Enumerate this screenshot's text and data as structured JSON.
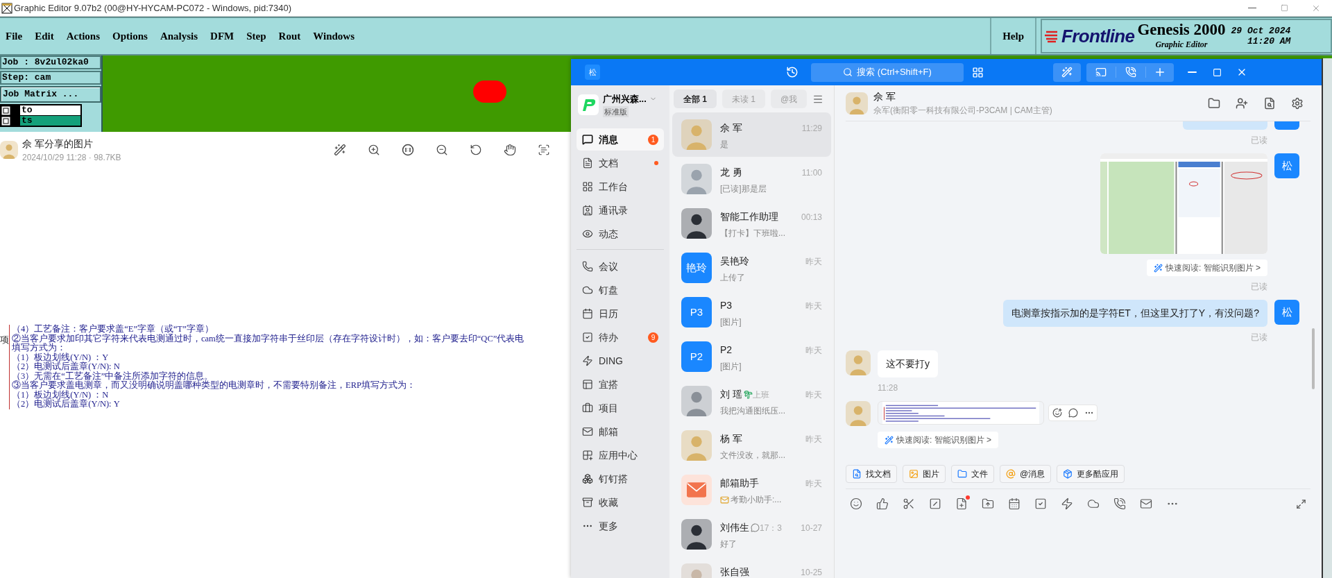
{
  "genesis": {
    "title": "Graphic Editor 9.07b2 (00@HY-HYCAM-PC072 - Windows, pid:7340)",
    "menu": [
      "File",
      "Edit",
      "Actions",
      "Options",
      "Analysis",
      "DFM",
      "Step",
      "Rout",
      "Windows"
    ],
    "help": "Help",
    "brand": {
      "logo": "Frontline",
      "product": "Genesis 2000",
      "subtitle": "Graphic Editor",
      "date": "29 Oct 2024",
      "time": "11:20 AM"
    },
    "job": "Job : 8v2ul02ka0",
    "step": "Step: cam",
    "matrix_button": "Job Matrix ...",
    "layers": [
      {
        "name": "to",
        "selected": false
      },
      {
        "name": "ts",
        "selected": true
      }
    ]
  },
  "viewer": {
    "title": "佘 军分享的图片",
    "meta": "2024/10/29 11:28 · 98.7KB",
    "side_label": "项",
    "lines": [
      "（4）工艺备注：客户要求盖“E”字章（或“T”字章）",
      "②当客户要求加印其它字符来代表电测通过时，cam统一直接加字符串于丝印层（存在字符设计时），如：客户要去印“QC”代表电",
      "填写方式为：",
      "（1）板边划线(Y/N) ：Y",
      "（2）电测试后盖章(Y/N): N",
      "（3）无需在“工艺备注”中备注所添加字符的信息。",
      "③当客户要求盖电测章，而又没明确说明盖哪种类型的电测章时，不需要特别备注，ERP填写方式为：",
      "（1）板边划线(Y/N) ：N",
      "（2）电测试后盖章(Y/N): Y"
    ]
  },
  "chat": {
    "account": "松",
    "search_placeholder": "搜索 (Ctrl+Shift+F)",
    "org": {
      "name": "广州兴森...",
      "edition": "标准版"
    },
    "nav_groups": [
      [
        {
          "label": "消息",
          "selected": true,
          "badge": "1",
          "dot": false
        },
        {
          "label": "文档",
          "selected": false,
          "dot": true
        },
        {
          "label": "工作台",
          "selected": false,
          "dot": false
        },
        {
          "label": "通讯录",
          "selected": false,
          "dot": false
        },
        {
          "label": "动态",
          "selected": false,
          "dot": false
        }
      ],
      [
        {
          "label": "会议",
          "selected": false,
          "dot": false
        },
        {
          "label": "钉盘",
          "selected": false,
          "dot": false
        },
        {
          "label": "日历",
          "selected": false,
          "dot": false
        },
        {
          "label": "待办",
          "selected": false,
          "badge": "9",
          "dot": false
        },
        {
          "label": "DING",
          "selected": false,
          "dot": false
        },
        {
          "label": "宜搭",
          "selected": false,
          "dot": false
        },
        {
          "label": "项目",
          "selected": false,
          "dot": false
        },
        {
          "label": "邮箱",
          "selected": false,
          "dot": false
        },
        {
          "label": "应用中心",
          "selected": false,
          "dot": false
        },
        {
          "label": "钉钉搭",
          "selected": false,
          "dot": false
        },
        {
          "label": "收藏",
          "selected": false,
          "dot": false
        },
        {
          "label": "更多",
          "selected": false,
          "dot": false
        }
      ]
    ],
    "tabs": [
      {
        "label": "全部 1",
        "selected": true
      },
      {
        "label": "未读 1",
        "selected": false
      },
      {
        "label": "@我",
        "selected": false
      }
    ],
    "conversations": [
      {
        "name": "佘 军",
        "time": "11:29",
        "preview": "是",
        "selected": true
      },
      {
        "name": "龙 勇",
        "time": "11:00",
        "preview": "[已读]那是层",
        "selected": false
      },
      {
        "name": "智能工作助理",
        "time": "00:13",
        "preview": "【打卡】下班啦...",
        "selected": false
      },
      {
        "name": "吴艳玲",
        "time": "昨天",
        "preview": "上传了",
        "avatar": {
          "kind": "tile",
          "text": "艳玲"
        },
        "selected": false
      },
      {
        "name": "P3",
        "time": "昨天",
        "preview": "[图片]",
        "avatar": {
          "kind": "tile",
          "text": "P3"
        },
        "selected": false
      },
      {
        "name": "P2",
        "time": "昨天",
        "preview": "[图片]",
        "avatar": {
          "kind": "tile",
          "text": "P2"
        },
        "selected": false
      },
      {
        "name": "刘 瑶",
        "time": "昨天",
        "preview": "我把沟通图纸压...",
        "status": {
          "kind": "vacation",
          "text": "上班"
        },
        "selected": false
      },
      {
        "name": "杨 军",
        "time": "昨天",
        "preview": "文件没改，就那...",
        "selected": false
      },
      {
        "name": "邮箱助手",
        "time": "昨天",
        "preview": "考勤小助手:...",
        "preview_icon": true,
        "avatar": {
          "kind": "mail"
        },
        "selected": false
      },
      {
        "name": "刘伟生",
        "time": "10-27",
        "preview": "好了",
        "status": {
          "kind": "message",
          "text": "17：3"
        },
        "selected": false
      },
      {
        "name": "张自强",
        "time": "10-25",
        "selected": false
      }
    ],
    "header": {
      "name": "佘 军",
      "subtitle": "佘军(衡阳零一科技有限公司-P3CAM | CAM主管)"
    },
    "messages": [
      {
        "kind": "partial",
        "outgoing": true,
        "receipt": "已读"
      },
      {
        "outgoing": true,
        "avatar": "松",
        "quick_read": "快速阅读: 智能识别图片 >",
        "receipt": "已读"
      },
      {
        "kind": "text",
        "outgoing": true,
        "avatar": "松",
        "text": "电测章按指示加的是字符ET，但这里又打了Y，有没问题?",
        "receipt": "已读"
      },
      {
        "kind": "text",
        "outgoing": false,
        "text": "这不要打y"
      },
      {
        "kind": "time",
        "text": "11:28"
      },
      {
        "outgoing": false,
        "quick_read": "快速阅读: 智能识别图片 >"
      }
    ],
    "quick_actions": [
      "找文档",
      "图片",
      "文件",
      "@消息",
      "更多酷应用"
    ]
  }
}
